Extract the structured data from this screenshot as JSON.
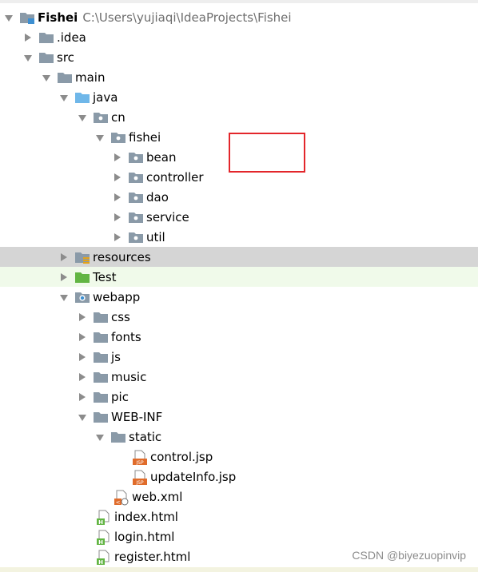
{
  "project": {
    "name": "Fishei",
    "path": "C:\\Users\\yujiaqi\\IdeaProjects\\Fishei"
  },
  "tree": {
    "idea": ".idea",
    "src": "src",
    "main": "main",
    "java": "java",
    "cn": "cn",
    "fishei": "fishei",
    "bean": "bean",
    "controller": "controller",
    "dao": "dao",
    "service": "service",
    "util": "util",
    "resources": "resources",
    "test": "Test",
    "webapp": "webapp",
    "css": "css",
    "fonts": "fonts",
    "js": "js",
    "music": "music",
    "pic": "pic",
    "web_inf": "WEB-INF",
    "static": "static",
    "control_jsp": "control.jsp",
    "updateinfo_jsp": "updateInfo.jsp",
    "web_xml": "web.xml",
    "index_html": "index.html",
    "login_html": "login.html",
    "register_html": "register.html"
  },
  "icons": {
    "jsp_badge": "JSP",
    "html_badge": "H",
    "xml_badge": "<"
  },
  "watermark": "CSDN @biyezuopinvip",
  "colors": {
    "folder": "#8a9aa8",
    "source_folder": "#6fb7e9",
    "test_folder": "#62b543",
    "selected_row": "#d5d5d5",
    "highlight": "#e3262b"
  }
}
